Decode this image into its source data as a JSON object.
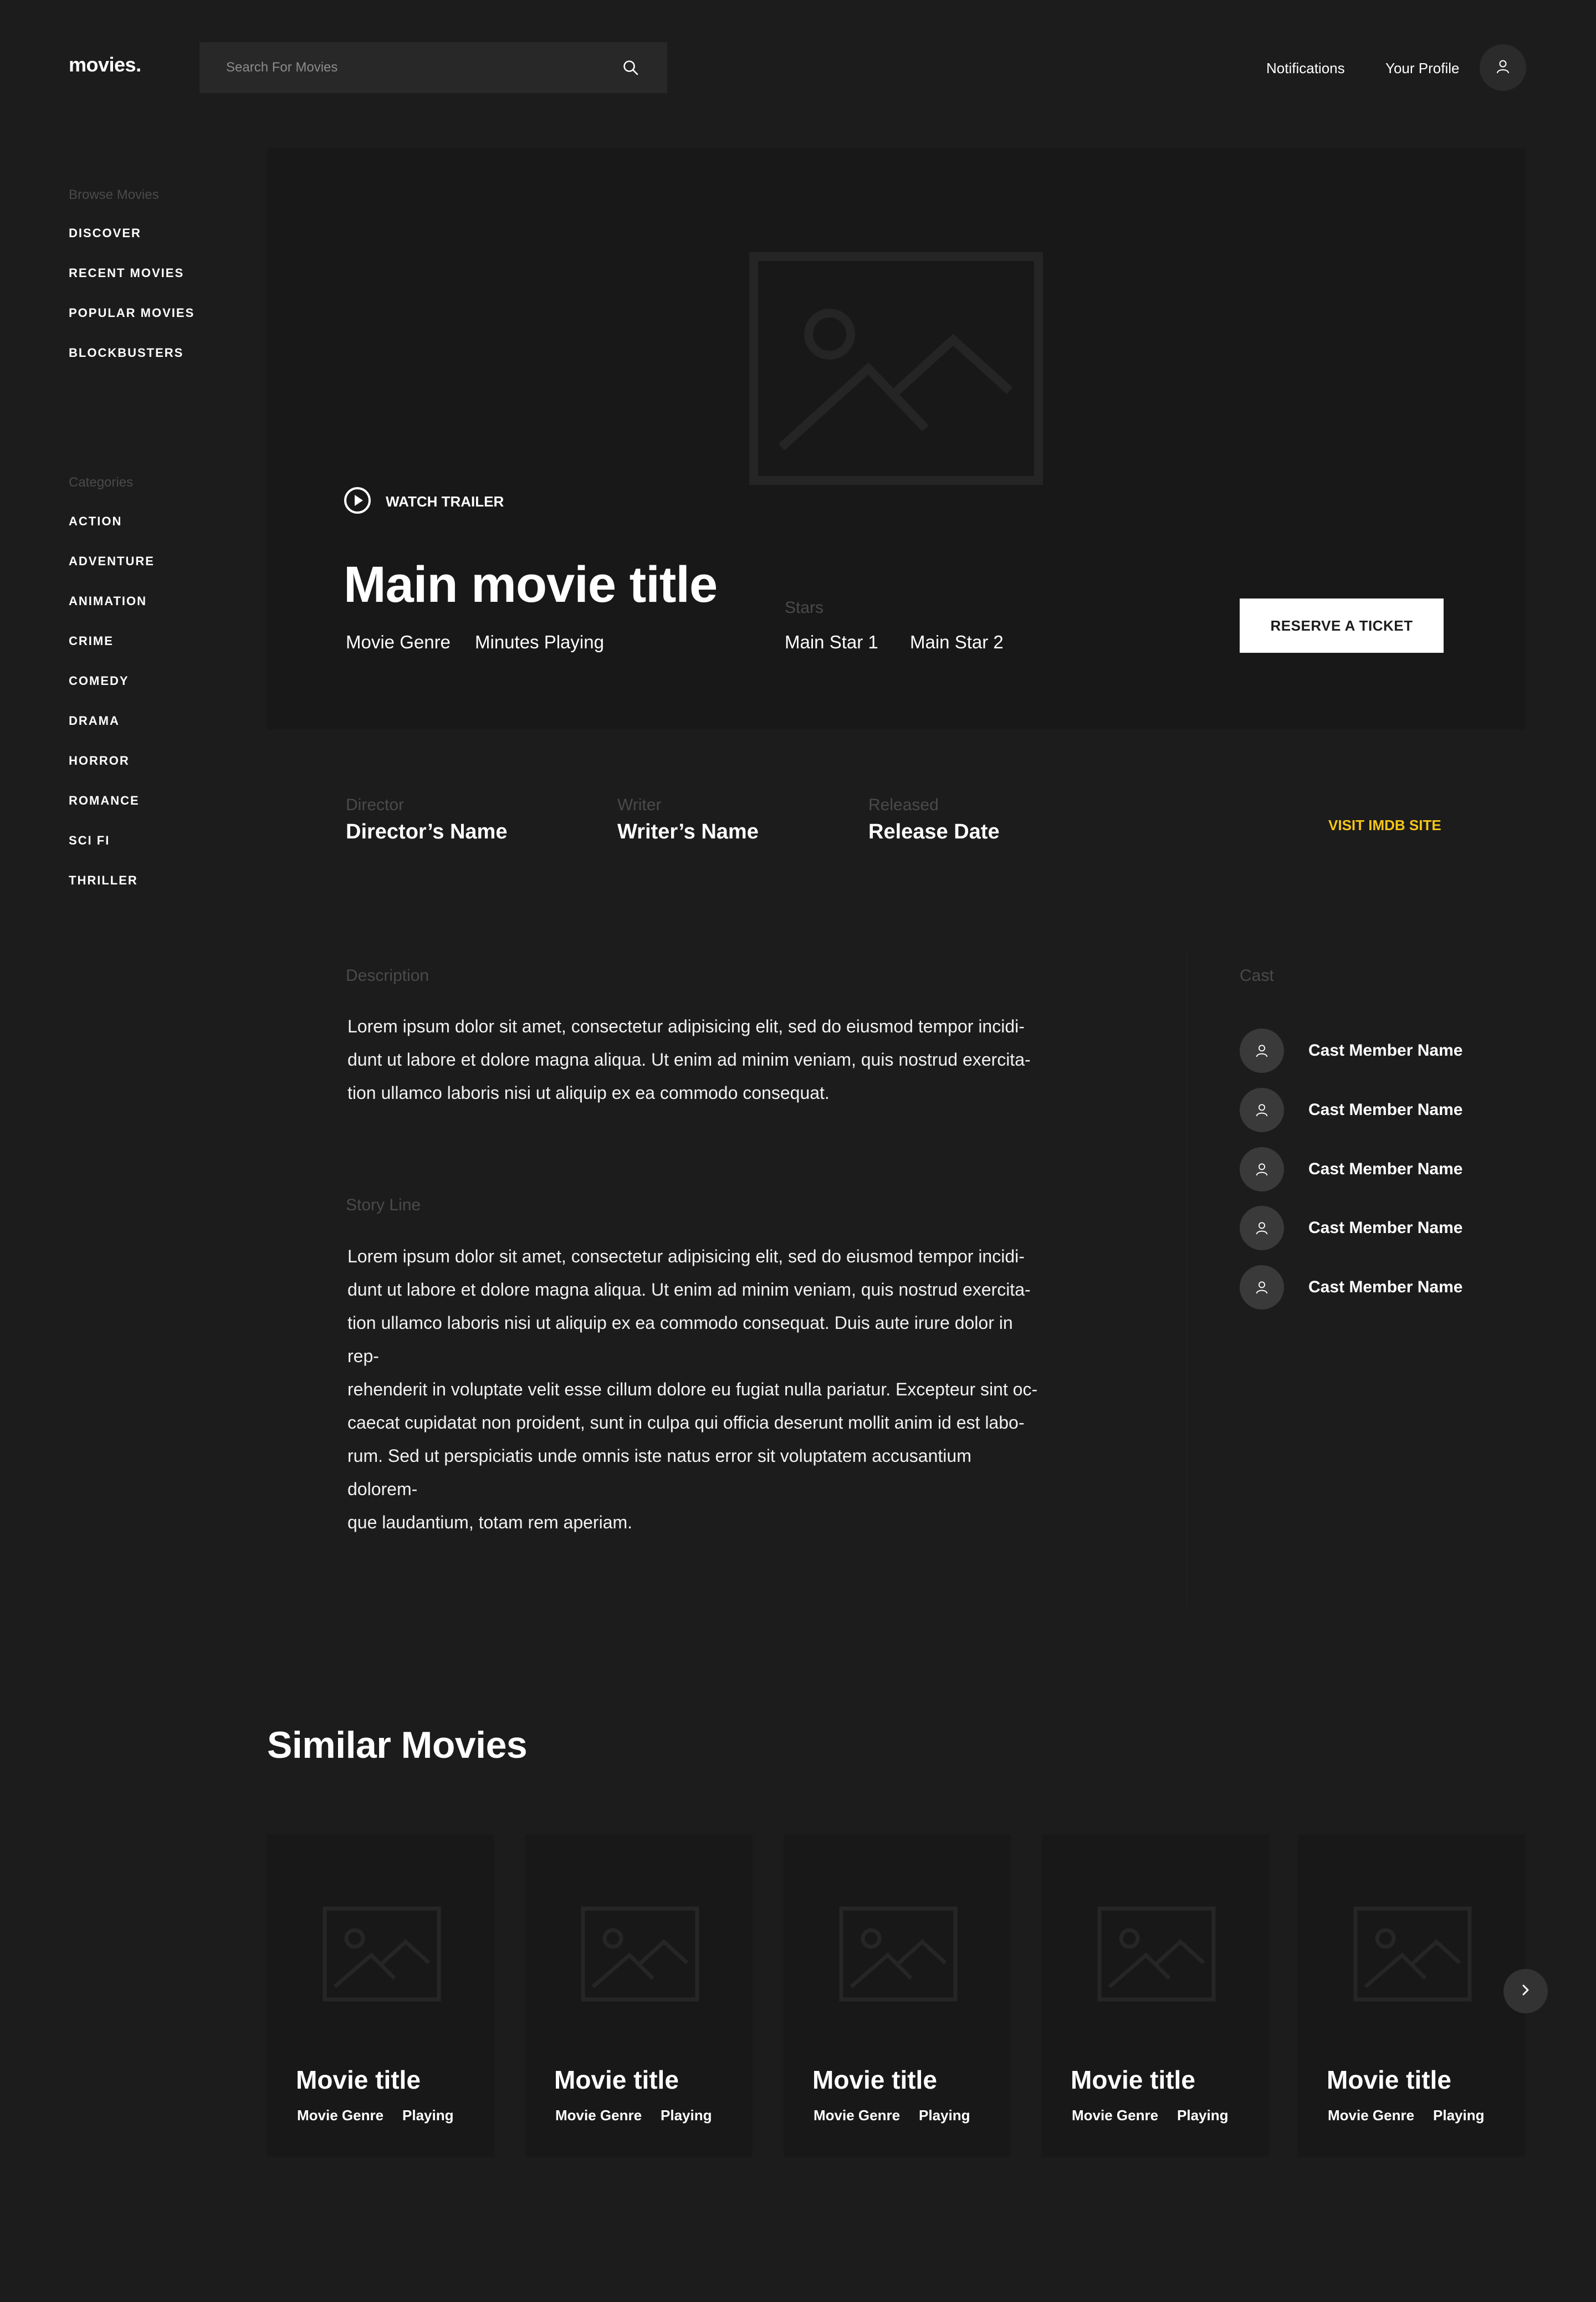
{
  "header": {
    "logo": "movies.",
    "search_placeholder": "Search For Movies",
    "notifications": "Notifications",
    "profile": "Your Profile"
  },
  "sidebar": {
    "browse_heading": "Browse Movies",
    "browse_items": [
      "DISCOVER",
      "RECENT MOVIES",
      "POPULAR MOVIES",
      "BLOCKBUSTERS"
    ],
    "categories_heading": "Categories",
    "categories": [
      "ACTION",
      "ADVENTURE",
      "ANIMATION",
      "CRIME",
      "COMEDY",
      "DRAMA",
      "HORROR",
      "ROMANCE",
      "SCI FI",
      "THRILLER"
    ]
  },
  "hero": {
    "watch_trailer": "WATCH TRAILER",
    "title": "Main movie title",
    "genre": "Movie Genre",
    "duration": "Minutes Playing",
    "stars_label": "Stars",
    "star1": "Main Star 1",
    "star2": "Main Star 2",
    "reserve": "RESERVE A TICKET"
  },
  "credits": {
    "director_label": "Director",
    "director": "Director’s Name",
    "writer_label": "Writer",
    "writer": "Writer’s Name",
    "released_label": "Released",
    "released": "Release Date",
    "imdb": "VISIT IMDB SITE"
  },
  "description": {
    "label": "Description",
    "lines": [
      "Lorem ipsum dolor sit amet, consectetur adipisicing elit, sed do eiusmod tempor incidi-",
      "dunt ut labore et dolore magna aliqua. Ut enim ad minim veniam, quis nostrud exercita-",
      "tion ullamco laboris nisi ut aliquip ex ea commodo consequat."
    ]
  },
  "storyline": {
    "label": "Story Line",
    "lines": [
      "Lorem ipsum dolor sit amet, consectetur adipisicing elit, sed do eiusmod tempor incidi-",
      "dunt ut labore et dolore magna aliqua. Ut enim ad minim veniam, quis nostrud exercita-",
      "tion ullamco laboris nisi ut aliquip ex ea commodo consequat. Duis aute irure dolor in rep-",
      "rehenderit in voluptate velit esse cillum dolore eu fugiat nulla pariatur. Excepteur sint oc-",
      "caecat cupidatat non proident, sunt in culpa qui officia deserunt mollit anim id est labo-",
      "rum. Sed ut perspiciatis unde omnis iste natus error sit voluptatem accusantium dolorem-",
      "que laudantium, totam rem aperiam."
    ]
  },
  "cast": {
    "label": "Cast",
    "members": [
      "Cast Member Name",
      "Cast Member Name",
      "Cast Member Name",
      "Cast Member Name",
      "Cast Member Name"
    ]
  },
  "similar": {
    "title": "Similar Movies",
    "movies": [
      {
        "title": "Movie title",
        "genre": "Movie Genre",
        "status": "Playing"
      },
      {
        "title": "Movie title",
        "genre": "Movie Genre",
        "status": "Playing"
      },
      {
        "title": "Movie title",
        "genre": "Movie Genre",
        "status": "Playing"
      },
      {
        "title": "Movie title",
        "genre": "Movie Genre",
        "status": "Playing"
      },
      {
        "title": "Movie title",
        "genre": "Movie Genre",
        "status": "Playing"
      }
    ]
  },
  "colors": {
    "background": "#1c1c1c",
    "panel": "#181818",
    "accent": "#f5c518",
    "muted_label": "#4a4a4a"
  },
  "icons": [
    "search-icon",
    "user-icon",
    "play-icon",
    "image-placeholder-icon",
    "chevron-right-icon"
  ]
}
